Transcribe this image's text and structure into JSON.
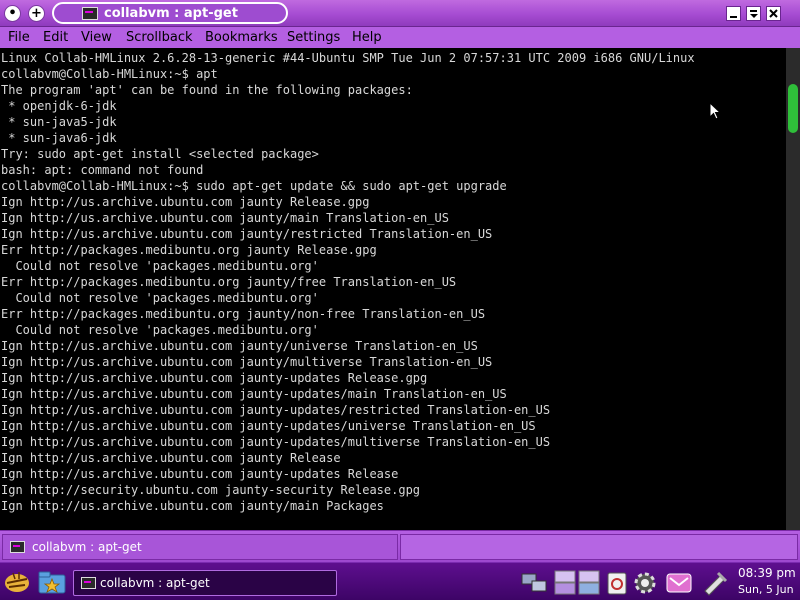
{
  "window": {
    "title": "collabvm : apt-get",
    "pin_symbol": "•",
    "new_symbol": "+"
  },
  "menu": [
    "File",
    "Edit",
    "View",
    "Scrollback",
    "Bookmarks",
    "Settings",
    "Help"
  ],
  "terminal": {
    "lines": [
      "Linux Collab-HMLinux 2.6.28-13-generic #44-Ubuntu SMP Tue Jun 2 07:57:31 UTC 2009 i686 GNU/Linux",
      "collabvm@Collab-HMLinux:~$ apt",
      "The program 'apt' can be found in the following packages:",
      " * openjdk-6-jdk",
      " * sun-java5-jdk",
      " * sun-java6-jdk",
      "Try: sudo apt-get install <selected package>",
      "bash: apt: command not found",
      "collabvm@Collab-HMLinux:~$ sudo apt-get update && sudo apt-get upgrade",
      "Ign http://us.archive.ubuntu.com jaunty Release.gpg",
      "Ign http://us.archive.ubuntu.com jaunty/main Translation-en_US",
      "Ign http://us.archive.ubuntu.com jaunty/restricted Translation-en_US",
      "Err http://packages.medibuntu.org jaunty Release.gpg",
      "  Could not resolve 'packages.medibuntu.org'",
      "Err http://packages.medibuntu.org jaunty/free Translation-en_US",
      "  Could not resolve 'packages.medibuntu.org'",
      "Err http://packages.medibuntu.org jaunty/non-free Translation-en_US",
      "  Could not resolve 'packages.medibuntu.org'",
      "Ign http://us.archive.ubuntu.com jaunty/universe Translation-en_US",
      "Ign http://us.archive.ubuntu.com jaunty/multiverse Translation-en_US",
      "Ign http://us.archive.ubuntu.com jaunty-updates Release.gpg",
      "Ign http://us.archive.ubuntu.com jaunty-updates/main Translation-en_US",
      "Ign http://us.archive.ubuntu.com jaunty-updates/restricted Translation-en_US",
      "Ign http://us.archive.ubuntu.com jaunty-updates/universe Translation-en_US",
      "Ign http://us.archive.ubuntu.com jaunty-updates/multiverse Translation-en_US",
      "Ign http://us.archive.ubuntu.com jaunty Release",
      "Ign http://us.archive.ubuntu.com jaunty-updates Release",
      "Ign http://security.ubuntu.com jaunty-security Release.gpg",
      "Ign http://us.archive.ubuntu.com jaunty/main Packages"
    ]
  },
  "status_tab": {
    "label": "collabvm : apt-get"
  },
  "taskbar": {
    "task_label": "collabvm : apt-get",
    "clock_time": "08:39 pm",
    "clock_date": "Sun, 5 Jun"
  },
  "colors": {
    "accent": "#a64cd2",
    "terminal_bg": "#000000",
    "terminal_fg": "#d8d8d8",
    "scroll_thumb": "#2fbf3a",
    "taskbar": "#4a0878"
  },
  "icons": {
    "title_left": [
      "pin-icon",
      "new-tab-icon",
      "terminal-app-icon"
    ],
    "window_controls": [
      "minimize-icon",
      "shade-icon",
      "close-icon"
    ],
    "taskbar_left": [
      "kde-menu-icon",
      "folder-star-icon"
    ],
    "tray": [
      "network-icon",
      "pager-icon",
      "desktop-icon",
      "clipboard-icon",
      "settings-gear-icon",
      "mail-icon",
      "tools-icon"
    ]
  }
}
